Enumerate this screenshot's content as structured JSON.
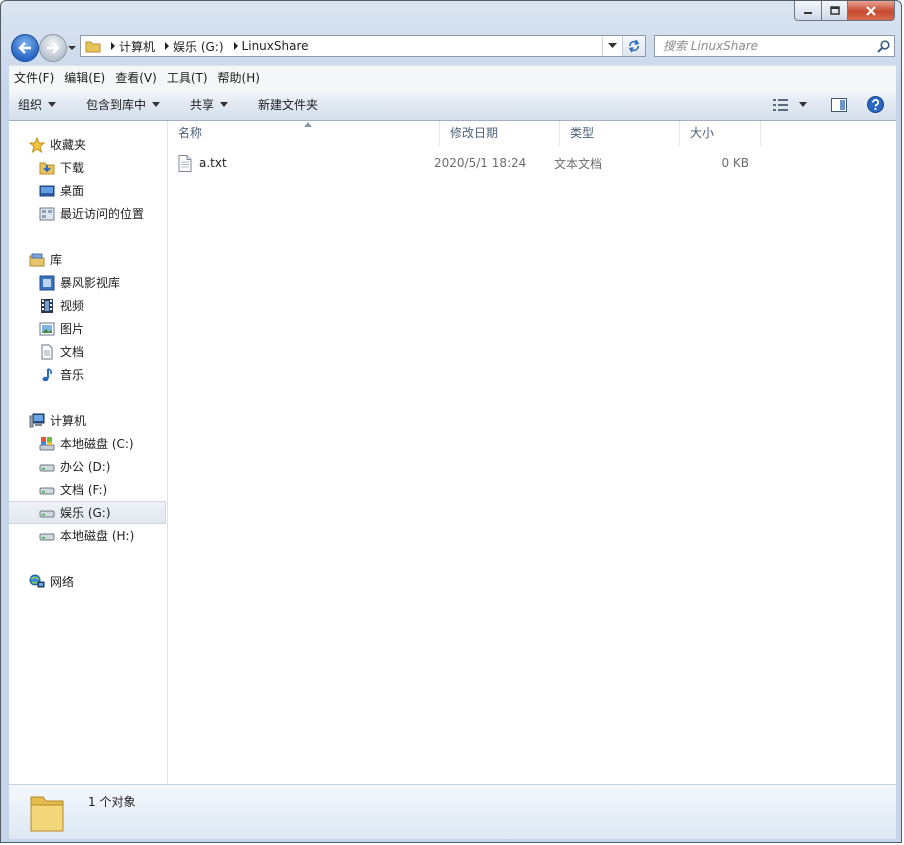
{
  "title_controls": {
    "minimize": "minimize",
    "maximize": "maximize",
    "close": "close"
  },
  "address": {
    "breadcrumbs": [
      "计算机",
      "娱乐 (G:)",
      "LinuxShare"
    ]
  },
  "search": {
    "placeholder": "搜索 LinuxShare"
  },
  "menu": [
    "文件(F)",
    "编辑(E)",
    "查看(V)",
    "工具(T)",
    "帮助(H)"
  ],
  "toolbar": {
    "organize": "组织",
    "include_library": "包含到库中",
    "share": "共享",
    "new_folder": "新建文件夹"
  },
  "sidebar": {
    "favorites": {
      "label": "收藏夹",
      "items": [
        "下载",
        "桌面",
        "最近访问的位置"
      ]
    },
    "libraries": {
      "label": "库",
      "items": [
        "暴风影视库",
        "视频",
        "图片",
        "文档",
        "音乐"
      ]
    },
    "computer": {
      "label": "计算机",
      "items": [
        "本地磁盘 (C:)",
        "办公 (D:)",
        "文档 (F:)",
        "娱乐 (G:)",
        "本地磁盘 (H:)"
      ],
      "selected": "娱乐 (G:)"
    },
    "network": {
      "label": "网络"
    }
  },
  "columns": [
    "名称",
    "修改日期",
    "类型",
    "大小"
  ],
  "files": [
    {
      "name": "a.txt",
      "modified": "2020/5/1 18:24",
      "type": "文本文档",
      "size": "0 KB"
    }
  ],
  "details": {
    "count_text": "1 个对象"
  },
  "colors": {
    "accent": "#2a66c4",
    "selection": "#e3e8ef",
    "column_header_text": "#4c607a"
  }
}
